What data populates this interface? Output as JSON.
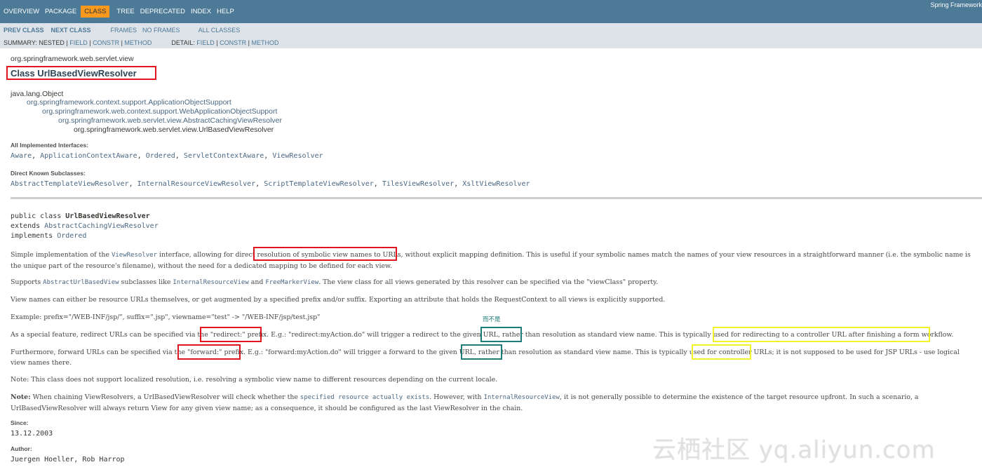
{
  "topnav": {
    "items": [
      "OVERVIEW",
      "PACKAGE",
      "CLASS",
      "TREE",
      "DEPRECATED",
      "INDEX",
      "HELP"
    ],
    "active": "CLASS",
    "about": "Spring Framework"
  },
  "subnav": {
    "prev_class": "PREV CLASS",
    "next_class": "NEXT CLASS",
    "frames": "FRAMES",
    "no_frames": "NO FRAMES",
    "all_classes": "ALL CLASSES",
    "summary_label": "SUMMARY: ",
    "summary_items": [
      "NESTED",
      "FIELD",
      "CONSTR",
      "METHOD"
    ],
    "detail_label": "DETAIL: ",
    "detail_items": [
      "FIELD",
      "CONSTR",
      "METHOD"
    ],
    "separator": " | "
  },
  "header": {
    "package": "org.springframework.web.servlet.view",
    "title": "Class UrlBasedViewResolver"
  },
  "inheritance": [
    "java.lang.Object",
    "org.springframework.context.support.ApplicationObjectSupport",
    "org.springframework.web.context.support.WebApplicationObjectSupport",
    "org.springframework.web.servlet.view.AbstractCachingViewResolver",
    "org.springframework.web.servlet.view.UrlBasedViewResolver"
  ],
  "interfaces": {
    "label": "All Implemented Interfaces:",
    "items": [
      "Aware",
      "ApplicationContextAware",
      "Ordered",
      "ServletContextAware",
      "ViewResolver"
    ]
  },
  "subclasses": {
    "label": "Direct Known Subclasses:",
    "items": [
      "AbstractTemplateViewResolver",
      "InternalResourceViewResolver",
      "ScriptTemplateViewResolver",
      "TilesViewResolver",
      "XsltViewResolver"
    ]
  },
  "signature": {
    "decl": "public class ",
    "name": "UrlBasedViewResolver",
    "extends_kw": "extends ",
    "extends": "AbstractCachingViewResolver",
    "implements_kw": "implements ",
    "implements": "Ordered"
  },
  "description": {
    "p1": {
      "a": "Simple implementation of the ",
      "code": "ViewResolver",
      "b": " interface, allowing for direct ",
      "hl": "resolution of symbolic view names to URLs",
      "c": ", without explicit mapping definition. This is useful if your symbolic names match the names of your view resources in a straightforward manner (i.e. the symbolic name is the unique part of the resource's filename), without the need for a dedicated mapping to be defined for each view."
    },
    "p2": {
      "a": "Supports ",
      "code1": "AbstractUrlBasedView",
      "b": " subclasses like ",
      "code2": "InternalResourceView",
      "c": " and ",
      "code3": "FreeMarkerView",
      "d": ". The view class for all views generated by this resolver can be specified via the \"viewClass\" property."
    },
    "p3": "View names can either be resource URLs themselves, or get augmented by a specified prefix and/or suffix. Exporting an attribute that holds the RequestContext to all views is explicitly supported.",
    "p4": "Example: prefix=\"/WEB-INF/jsp/\", suffix=\".jsp\", viewname=\"test\" -> \"/WEB-INF/jsp/test.jsp\"",
    "annotation": "而不是",
    "p5": {
      "a": "As a special feature, redirect URLs can be specified via the ",
      "hl1": "\"redirect:\" prefix",
      "b": ". E.g.: \"redirect:myAction.do\" will trigger a redirect to the given URL, ",
      "hl2": "rather than",
      "c": " resolution as standard view name. This is typically used for ",
      "hl3": "redirecting to a controller URL after finishing a form workflow",
      "d": "."
    },
    "p6": {
      "a": "Furthermore, forward URLs can be specified via the ",
      "hl1": "\"forward:\" prefix",
      "b": ". E.g.: \"forward:myAction.do\" will trigger a forward to the given URL, ",
      "hl2": "rather than",
      "c": " resolution as standard view name. This is typically used for ",
      "hl3": "controller URLs",
      "d": "; it is not supposed to be used for JSP URLs - use logical view names there."
    },
    "p7": "Note: This class does not support localized resolution, i.e. resolving a symbolic view name to different resources depending on the current locale.",
    "p8": {
      "bold": "Note:",
      "a": " When chaining ViewResolvers, a UrlBasedViewResolver will check whether the ",
      "code1": "specified resource actually exists",
      "b": ". However, with ",
      "code2": "InternalResourceView",
      "c": ", it is not generally possible to determine the existence of the target resource upfront. In such a scenario, a UrlBasedViewResolver will always return View for any given view name; as a consequence, it should be configured as the last ViewResolver in the chain."
    }
  },
  "since": {
    "label": "Since:",
    "value": "13.12.2003"
  },
  "author": {
    "label": "Author:",
    "value": "Juergen Hoeller, Rob Harrop"
  },
  "watermark": "云栖社区 yq.aliyun.com"
}
